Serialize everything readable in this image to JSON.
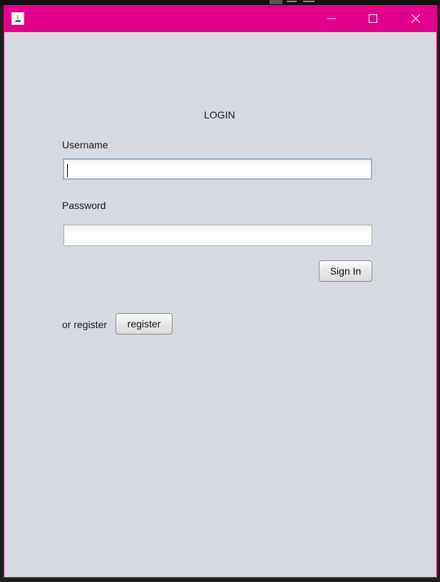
{
  "window": {
    "title": "",
    "controls": {
      "minimize_icon": "minimize-icon",
      "maximize_icon": "maximize-icon",
      "close_icon": "close-icon"
    },
    "accent_color": "#e3008c",
    "background_color": "#d6d9e0"
  },
  "form": {
    "title": "LOGIN",
    "username_label": "Username",
    "username_value": "",
    "password_label": "Password",
    "password_value": "",
    "signin_label": "Sign In",
    "or_register_text": "or register",
    "register_label": "register"
  }
}
